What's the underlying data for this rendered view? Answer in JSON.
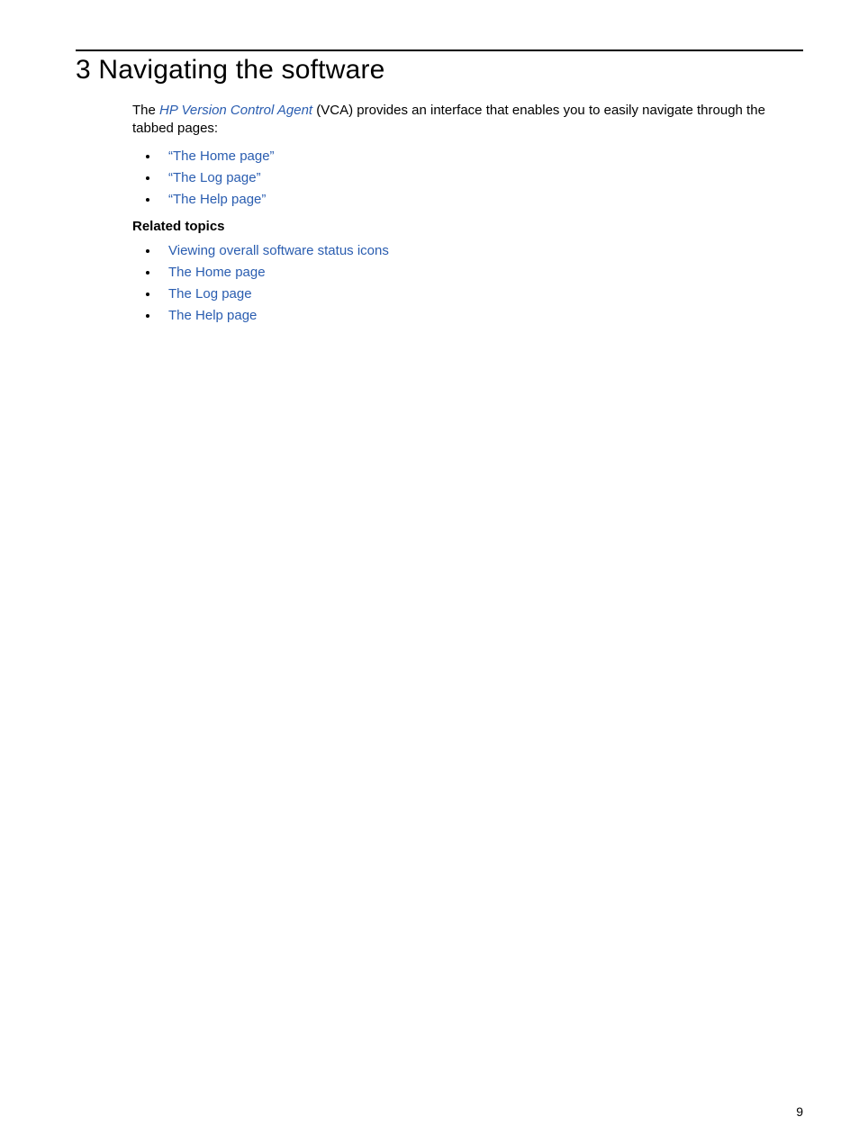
{
  "chapter": {
    "title": "3 Navigating the software"
  },
  "intro": {
    "pre": "The ",
    "term": "HP Version Control Agent",
    "post": " (VCA) provides an interface that enables you to easily navigate through the tabbed pages:"
  },
  "tabbed_pages": [
    "“The Home page”",
    "“The Log page”",
    "“The Help page”"
  ],
  "related_heading": "Related topics",
  "related_topics": [
    "Viewing overall software status icons",
    "The Home page",
    "The Log page",
    "The Help page"
  ],
  "page_number": "9"
}
